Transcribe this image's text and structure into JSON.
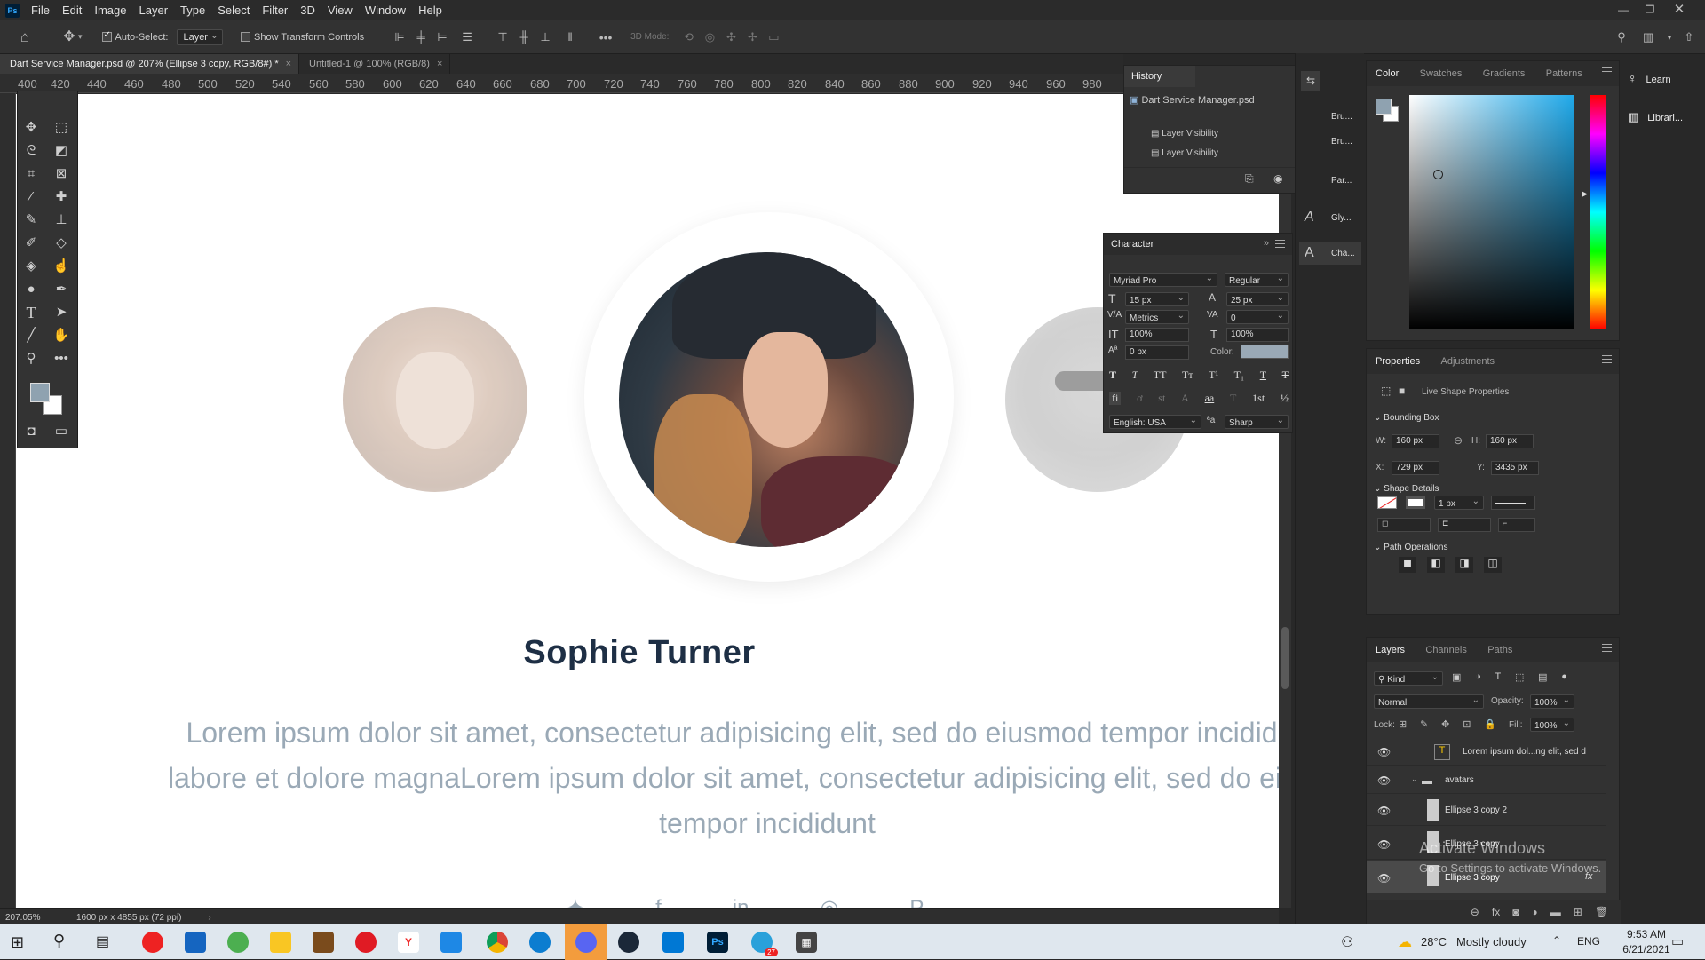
{
  "menubar": {
    "app_icon": "Ps",
    "items": [
      "File",
      "Edit",
      "Image",
      "Layer",
      "Type",
      "Select",
      "Filter",
      "3D",
      "View",
      "Window",
      "Help"
    ]
  },
  "options": {
    "auto_select_label": "Auto-Select:",
    "auto_select_target": "Layer",
    "show_transform_label": "Show Transform Controls",
    "mode_3d_label": "3D Mode:"
  },
  "tabs": [
    {
      "label": "Dart Service Manager.psd @ 207% (Ellipse 3 copy, RGB/8#) *"
    },
    {
      "label": "Untitled-1 @ 100% (RGB/8)"
    }
  ],
  "ruler": [
    "400",
    "420",
    "440",
    "460",
    "480",
    "500",
    "520",
    "540",
    "560",
    "580",
    "600",
    "620",
    "640",
    "660",
    "680",
    "700",
    "720",
    "740",
    "760",
    "780",
    "800",
    "820",
    "840",
    "860",
    "880",
    "900",
    "920",
    "940",
    "960",
    "980"
  ],
  "canvas": {
    "name": "Sophie Turner",
    "body": "Lorem ipsum dolor sit amet, consectetur adipisicing elit, sed do eiusmod tempor incididunt ut labore et dolore magnaLorem ipsum dolor sit amet, consectetur adipisicing elit, sed do eiusmod tempor incididunt"
  },
  "status": {
    "zoom": "207.05%",
    "doc_size": "1600 px x 4855 px (72 ppi)"
  },
  "history": {
    "title": "History",
    "snapshot": "Dart Service Manager.psd",
    "items": [
      "Layer Visibility",
      "Layer Visibility"
    ]
  },
  "collapsed_panels": [
    "Bru...",
    "Bru...",
    "Par...",
    "Gly...",
    "Cha..."
  ],
  "character": {
    "title": "Character",
    "font": "Myriad Pro",
    "style": "Regular",
    "size": "15 px",
    "leading": "25 px",
    "kerning": "Metrics",
    "tracking": "0",
    "vscale": "100%",
    "hscale": "100%",
    "baseline": "0 px",
    "color_label": "Color:",
    "color": "#9aa9b6",
    "language": "English: USA",
    "aa_symbol": "ªa",
    "antialias": "Sharp"
  },
  "color_panel": {
    "tabs": [
      "Color",
      "Swatches",
      "Gradients",
      "Patterns"
    ],
    "fg": "#8fa2b0",
    "hue": "#1fa9ea"
  },
  "learn": {
    "learn": "Learn",
    "libraries": "Librari..."
  },
  "properties": {
    "tabs": [
      "Properties",
      "Adjustments"
    ],
    "live_shape": "Live Shape Properties",
    "bounding_box": "Bounding Box",
    "w_label": "W:",
    "w": "160 px",
    "h_label": "H:",
    "h": "160 px",
    "x_label": "X:",
    "x": "729 px",
    "y_label": "Y:",
    "y": "3435 px",
    "shape_details": "Shape Details",
    "stroke": "1 px",
    "path_ops": "Path Operations"
  },
  "layers": {
    "tabs": [
      "Layers",
      "Channels",
      "Paths"
    ],
    "kind": "Kind",
    "blend": "Normal",
    "opacity_label": "Opacity:",
    "opacity": "100%",
    "lock_label": "Lock:",
    "fill_label": "Fill:",
    "fill": "100%",
    "rows": [
      "Lorem ipsum dol...ng elit, sed d",
      "avatars",
      "Ellipse 3 copy 2",
      "Ellipse 3 copy",
      "Ellipse 3 copy"
    ],
    "fx": "fx"
  },
  "watermark": {
    "title": "Activate Windows",
    "sub": "Go to Settings to activate Windows."
  },
  "taskbar": {
    "temp": "28°C",
    "weather": "Mostly cloudy",
    "lang": "ENG",
    "time": "9:53 AM",
    "date": "6/21/2021",
    "telegram_badge": "27"
  }
}
